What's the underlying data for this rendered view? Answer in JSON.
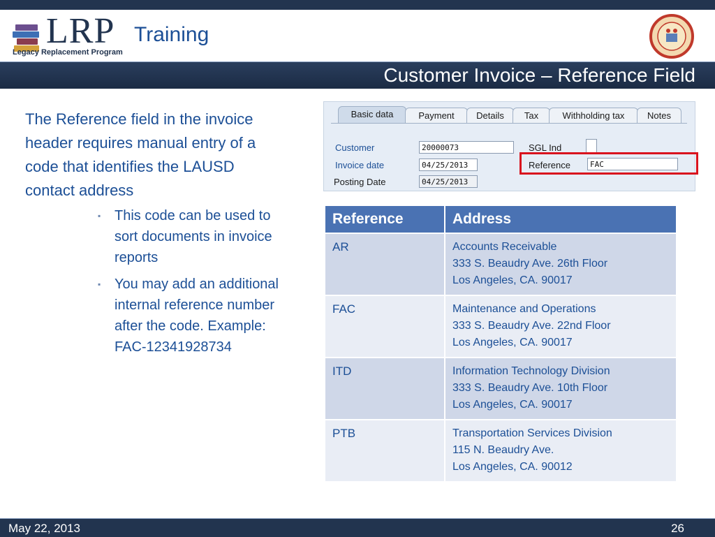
{
  "header": {
    "logo_text": "LRP",
    "logo_subtitle": "Legacy Replacement Program",
    "training_label": "Training",
    "title": "Customer Invoice – Reference Field"
  },
  "body": {
    "main_text": "The Reference field in the invoice header requires manual entry of a code that identifies the LAUSD contact address",
    "bullets": [
      "This code can be used to sort documents in invoice reports",
      "You may add an additional internal reference number after the code. Example: FAC-12341928734"
    ]
  },
  "sap": {
    "tabs": [
      "Basic data",
      "Payment",
      "Details",
      "Tax",
      "Withholding tax",
      "Notes"
    ],
    "active_tab": "Basic data",
    "fields": {
      "customer_label": "Customer",
      "customer_value": "20000073",
      "invoice_date_label": "Invoice date",
      "invoice_date_value": "04/25/2013",
      "posting_date_label": "Posting Date",
      "posting_date_value": "04/25/2013",
      "sgl_label": "SGL Ind",
      "reference_label": "Reference",
      "reference_value": "FAC"
    }
  },
  "table": {
    "headers": [
      "Reference",
      "Address"
    ],
    "rows": [
      {
        "code": "AR",
        "line1": "Accounts Receivable",
        "line2": "333 S. Beaudry Ave. 26th Floor",
        "line3": "Los Angeles, CA. 90017"
      },
      {
        "code": "FAC",
        "line1": "Maintenance and Operations",
        "line2": "333 S. Beaudry Ave. 22nd Floor",
        "line3": "Los Angeles, CA. 90017"
      },
      {
        "code": "ITD",
        "line1": "Information Technology Division",
        "line2": "333 S. Beaudry Ave. 10th Floor",
        "line3": "Los Angeles, CA. 90017"
      },
      {
        "code": "PTB",
        "line1": "Transportation Services Division",
        "line2": "115 N. Beaudry Ave.",
        "line3": "Los Angeles, CA. 90012"
      }
    ]
  },
  "footer": {
    "date": "May 22, 2013",
    "page": "26"
  },
  "colors": {
    "navy": "#22344f",
    "text_blue": "#1c4f96",
    "table_header": "#4a72b3",
    "highlight_red": "#d9131e"
  }
}
